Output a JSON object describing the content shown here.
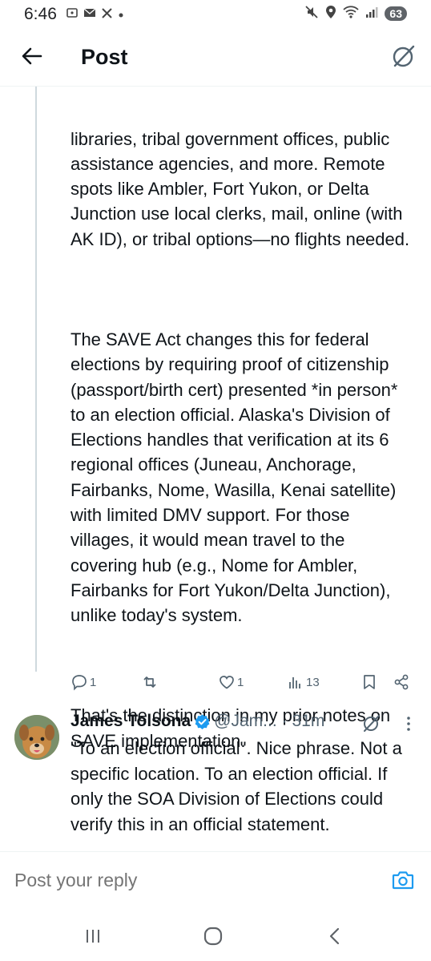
{
  "status_bar": {
    "time": "6:46",
    "battery": "63",
    "left_icons": [
      "screenshot-icon",
      "mail-icon",
      "x-logo-icon",
      "dot-icon"
    ],
    "right_icons": [
      "mute-icon",
      "location-icon",
      "wifi-icon",
      "signal-icon",
      "battery-icon"
    ]
  },
  "header": {
    "title": "Post"
  },
  "post": {
    "paragraphs": [
      "libraries, tribal government offices, public assistance agencies, and more. Remote spots like Ambler, Fort Yukon, or Delta Junction use local clerks, mail, online (with AK ID), or tribal options—no flights needed.",
      "The SAVE Act changes this for federal elections by requiring proof of citizenship (passport/birth cert) presented *in person* to an election official. Alaska's Division of Elections handles that verification at its 6 regional offices (Juneau, Anchorage, Fairbanks, Nome, Wasilla, Kenai satellite) with limited DMV support. For those villages, it would mean travel to the covering hub (e.g., Nome for Ambler, Fairbanks for Fort Yukon/Delta Junction), unlike today's system.",
      "That's the distinction in my prior notes on SAVE implementation."
    ],
    "actions": {
      "replies": "1",
      "reposts": "",
      "likes": "1",
      "views": "13"
    }
  },
  "reply": {
    "name": "James Tolsona",
    "handle": "@Jam...",
    "time": "· 31m",
    "text": "\"To an election official\". Nice phrase. Not a specific location. To an election official. If only the SOA Division of Elections could  verify this in an official statement."
  },
  "composer": {
    "placeholder": "Post your reply"
  },
  "colors": {
    "accent": "#1d9bf0",
    "text": "#0f1419",
    "secondary": "#536471"
  }
}
